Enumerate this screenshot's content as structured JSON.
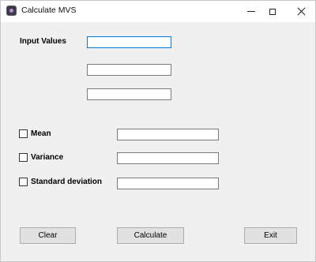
{
  "window": {
    "title": "Calculate MVS",
    "icon": "app-icon"
  },
  "inputs": {
    "label": "Input Values",
    "values": [
      "",
      "",
      ""
    ]
  },
  "options": [
    {
      "label": "Mean",
      "checked": false,
      "result": ""
    },
    {
      "label": "Variance",
      "checked": false,
      "result": ""
    },
    {
      "label": "Standard deviation",
      "checked": false,
      "result": ""
    }
  ],
  "buttons": {
    "clear": "Clear",
    "calculate": "Calculate",
    "exit": "Exit"
  }
}
